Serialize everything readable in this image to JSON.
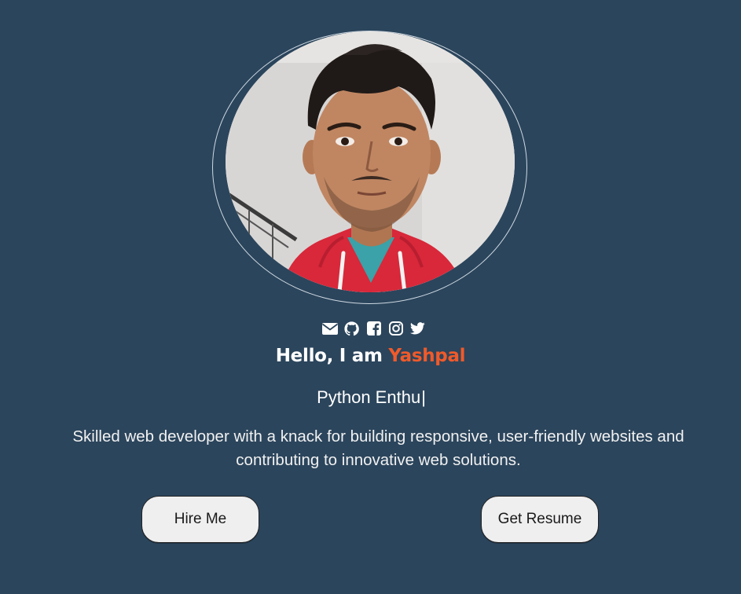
{
  "colors": {
    "background": "#2b455c",
    "accent": "#f05a2a",
    "button_bg": "#f0eff0",
    "text": "#ffffff"
  },
  "hero": {
    "greeting_prefix": "Hello, I am ",
    "name": "Yashpal",
    "typed_role": "Python Enthu",
    "caret": "|",
    "description": "Skilled web developer with a knack for building responsive, user-friendly websites and contributing to innovative web solutions."
  },
  "social": [
    {
      "icon": "mail-icon"
    },
    {
      "icon": "github-icon"
    },
    {
      "icon": "facebook-icon"
    },
    {
      "icon": "instagram-icon"
    },
    {
      "icon": "twitter-icon"
    }
  ],
  "buttons": {
    "hire_label": "Hire Me",
    "resume_label": "Get Resume"
  }
}
